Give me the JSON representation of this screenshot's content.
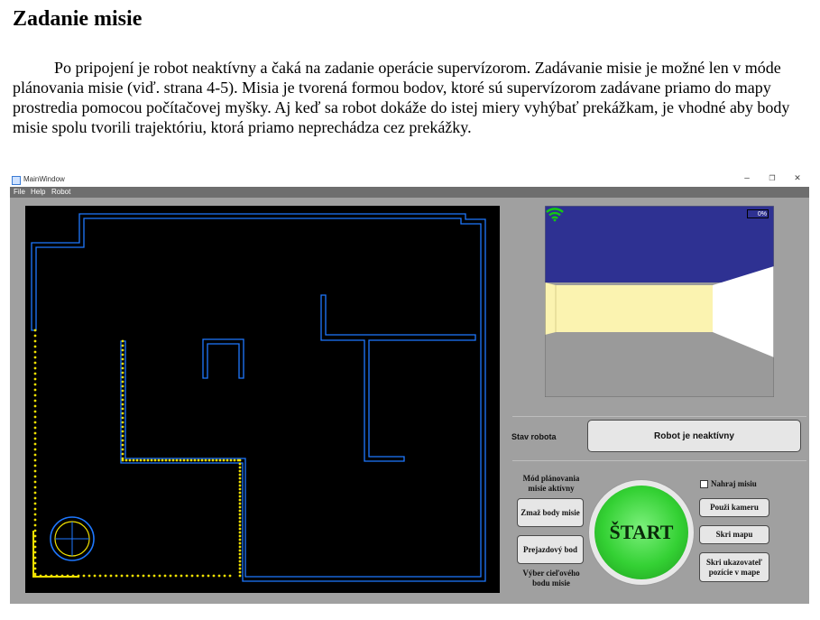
{
  "document": {
    "heading": "Zadanie misie",
    "paragraph": "Po pripojení je robot neaktívny a čaká na zadanie operácie supervízorom. Zadávanie misie je možné len v móde plánovania misie (viď. strana 4-5). Misia je tvorená formou bodov, ktoré sú supervízorom zadávane priamo do mapy prostredia pomocou počítačovej myšky. Aj keď sa robot dokáže do istej miery vyhýbať prekážkam, je vhodné aby body misie spolu tvorili trajektóriu, ktorá priamo neprechádza cez prekážky."
  },
  "window": {
    "title": "MainWindow",
    "controls": {
      "minimize": "–",
      "maximize": "❐",
      "close": "✕"
    },
    "menu": [
      "File",
      "Help",
      "Robot"
    ]
  },
  "camera": {
    "battery": "0%"
  },
  "status": {
    "label": "Stav robota",
    "value": "Robot je neaktívny"
  },
  "controls": {
    "mode_label": "Mód plánovania misie aktívny",
    "clear_points": "Zmaž body misie",
    "waypoint": "Prejazdový bod",
    "target_label": "Výber cieľového bodu misie",
    "start": "ŠTART",
    "record_mission": "Nahraj misiu",
    "use_camera": "Použi kameru",
    "hide_map": "Skri mapu",
    "hide_pointer": "Skri ukazovateľ pozície v mape"
  },
  "colors": {
    "walls": "#1e78ff",
    "path": "#f0e000",
    "robot": "#1e78ff",
    "sky": "#2e3192",
    "floor": "#9a9a9a",
    "start": "#34d134"
  }
}
